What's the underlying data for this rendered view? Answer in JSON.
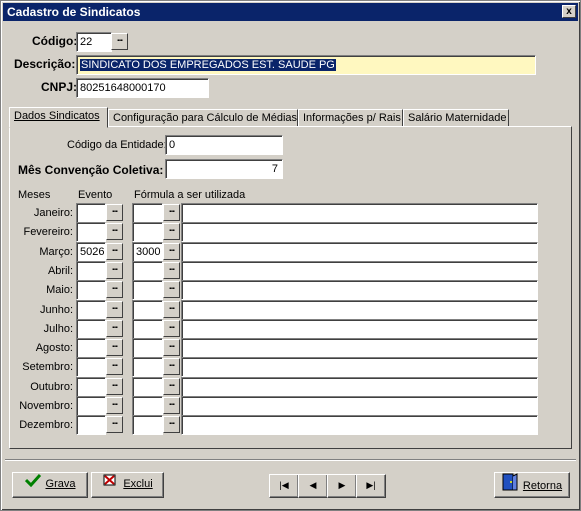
{
  "window": {
    "title": "Cadastro de Sindicatos",
    "close_label": "x"
  },
  "header": {
    "codigo_label": "Código:",
    "codigo_value": "22",
    "descricao_label": "Descrição:",
    "descricao_value": "SINDICATO DOS EMPREGADOS EST. SAUDE PG",
    "cnpj_label": "CNPJ:",
    "cnpj_value": "80251648000170"
  },
  "tabs": [
    {
      "label": "Dados Sindicatos",
      "active": true
    },
    {
      "label": "Configuração para Cálculo de Médias",
      "active": false
    },
    {
      "label": "Informações p/ Rais",
      "active": false
    },
    {
      "label": "Salário Maternidade",
      "active": false
    }
  ],
  "dados": {
    "codigo_entidade_label": "Código da Entidade:",
    "codigo_entidade_value": "0",
    "mes_convencao_label": "Mês Convenção Coletiva:",
    "mes_convencao_value": "7",
    "col_meses": "Meses",
    "col_evento": "Evento",
    "col_formula": "Fórmula a ser utilizada",
    "months": [
      {
        "name": "Janeiro:",
        "evento": "",
        "formula": ""
      },
      {
        "name": "Fevereiro:",
        "evento": "",
        "formula": ""
      },
      {
        "name": "Março:",
        "evento": "5026",
        "formula": "3000"
      },
      {
        "name": "Abril:",
        "evento": "",
        "formula": ""
      },
      {
        "name": "Maio:",
        "evento": "",
        "formula": ""
      },
      {
        "name": "Junho:",
        "evento": "",
        "formula": ""
      },
      {
        "name": "Julho:",
        "evento": "",
        "formula": ""
      },
      {
        "name": "Agosto:",
        "evento": "",
        "formula": ""
      },
      {
        "name": "Setembro:",
        "evento": "",
        "formula": ""
      },
      {
        "name": "Outubro:",
        "evento": "",
        "formula": ""
      },
      {
        "name": "Novembro:",
        "evento": "",
        "formula": ""
      },
      {
        "name": "Dezembro:",
        "evento": "",
        "formula": ""
      }
    ]
  },
  "footer": {
    "grava_label": "Grava",
    "exclui_label": "Exclui",
    "retorna_label": "Retorna"
  },
  "icons": {
    "first": "first-record-icon",
    "prev": "previous-record-icon",
    "next": "next-record-icon",
    "last": "last-record-icon"
  },
  "colors": {
    "titlebar": "#0a246a",
    "face": "#d4d0c8",
    "desc_bg": "#fff8c0"
  }
}
